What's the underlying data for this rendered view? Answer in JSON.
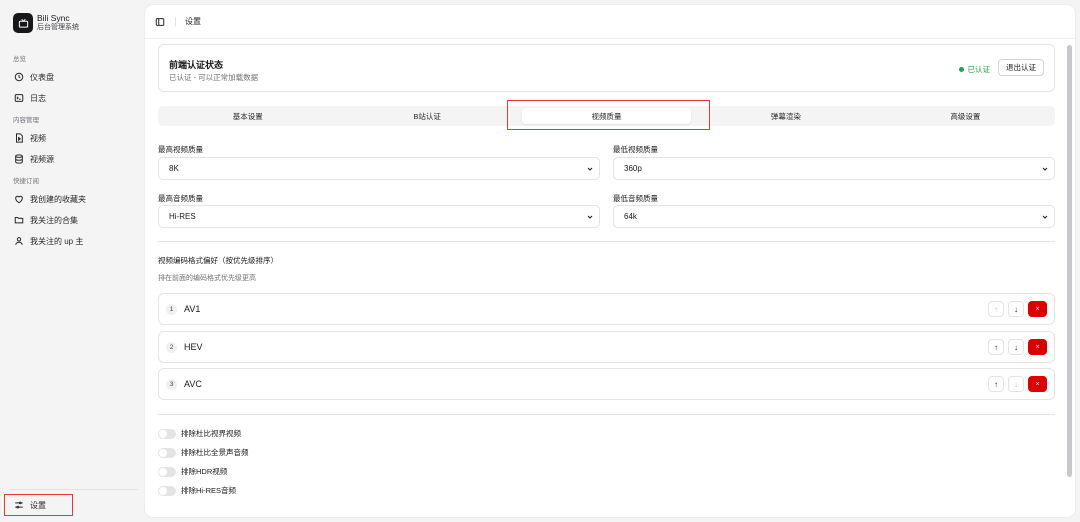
{
  "brand": {
    "name": "Bili Sync",
    "subtitle": "后台管理系统"
  },
  "sidebar": {
    "groups": [
      {
        "label": "总览",
        "items": [
          {
            "label": "仪表盘",
            "icon": "clock-icon"
          },
          {
            "label": "日志",
            "icon": "terminal-icon"
          }
        ]
      },
      {
        "label": "内容管理",
        "items": [
          {
            "label": "视频",
            "icon": "video-file-icon"
          },
          {
            "label": "视频源",
            "icon": "database-icon"
          }
        ]
      },
      {
        "label": "快捷订阅",
        "items": [
          {
            "label": "我创建的收藏夹",
            "icon": "heart-icon"
          },
          {
            "label": "我关注的合集",
            "icon": "folder-icon"
          },
          {
            "label": "我关注的 up 主",
            "icon": "user-icon"
          }
        ]
      }
    ],
    "settings": {
      "label": "设置",
      "icon": "sliders-icon"
    }
  },
  "header": {
    "breadcrumb": "设置"
  },
  "auth": {
    "title": "前端认证状态",
    "description": "已认证 - 可以正常加载数据",
    "status": "已认证",
    "status_color": "#16a34a",
    "logout_label": "退出认证"
  },
  "tabs": [
    {
      "label": "基本设置",
      "active": false
    },
    {
      "label": "B站认证",
      "active": false
    },
    {
      "label": "视频质量",
      "active": true
    },
    {
      "label": "弹幕渲染",
      "active": false
    },
    {
      "label": "高级设置",
      "active": false
    }
  ],
  "quality": {
    "max_video": {
      "label": "最高视频质量",
      "value": "8K"
    },
    "min_video": {
      "label": "最低视频质量",
      "value": "360p"
    },
    "max_audio": {
      "label": "最高音频质量",
      "value": "Hi-RES"
    },
    "min_audio": {
      "label": "最低音频质量",
      "value": "64k"
    }
  },
  "codec": {
    "title": "视频编码格式偏好（按优先级排序）",
    "subtitle": "排在前面的编码格式优先级更高",
    "items": [
      {
        "index": "1",
        "name": "AV1",
        "up_enabled": false,
        "down_enabled": true
      },
      {
        "index": "2",
        "name": "HEV",
        "up_enabled": true,
        "down_enabled": true
      },
      {
        "index": "3",
        "name": "AVC",
        "up_enabled": true,
        "down_enabled": false
      }
    ],
    "up_label": "↑",
    "down_label": "↓",
    "delete_label": "×",
    "delete_color": "#dc0000"
  },
  "toggles": [
    {
      "label": "排除杜比视界视频",
      "on": false
    },
    {
      "label": "排除杜比全景声音频",
      "on": false
    },
    {
      "label": "排除HDR视频",
      "on": false
    },
    {
      "label": "排除Hi-RES音频",
      "on": false
    }
  ],
  "colors": {
    "accent": "#18181b",
    "highlight": "#e53935"
  }
}
